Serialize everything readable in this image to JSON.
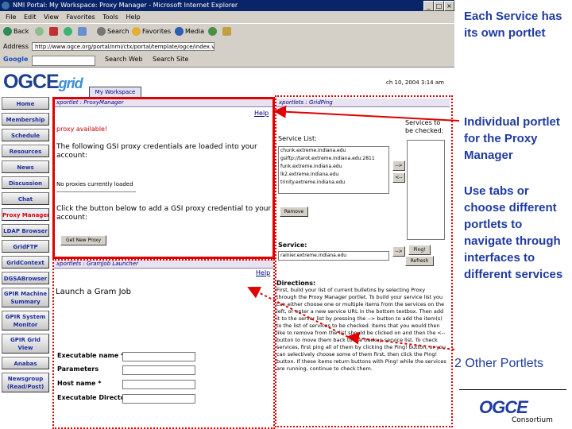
{
  "browser": {
    "window_title": "NMI Portal: My Workspace: Proxy Manager - Microsoft Internet Explorer",
    "menu": [
      "File",
      "Edit",
      "View",
      "Favorites",
      "Tools",
      "Help"
    ],
    "toolbar": {
      "back": "Back",
      "search": "Search",
      "favorites": "Favorites",
      "media": "Media"
    },
    "address_label": "Address",
    "address_value": "http://www.ogce.org/portal/nmi/ctx/portal/template/ogce/index.vm?js_pane=p-0f94ea56f0...",
    "google_label": "Google",
    "google_search": "Search Web",
    "google_site": "Search Site"
  },
  "page": {
    "logo_main": "OGCE",
    "logo_sub": "grid",
    "datestamp": "ch 10, 2004 3:14 am",
    "workspace_tab": "My Workspace",
    "nav": [
      {
        "label": "Home"
      },
      {
        "label": "Membership"
      },
      {
        "label": "Schedule"
      },
      {
        "label": "Resources"
      },
      {
        "label": "News"
      },
      {
        "label": "Discussion"
      },
      {
        "label": "Chat"
      },
      {
        "label": "Proxy Manager"
      },
      {
        "label": "LDAP Browser"
      },
      {
        "label": "GridFTP"
      },
      {
        "label": "GridContext"
      },
      {
        "label": "DGSABrowser"
      },
      {
        "label": "GPIR Machine Summary"
      },
      {
        "label": "GPIR System Monitor"
      },
      {
        "label": "GPIR Grid View"
      },
      {
        "label": "Anabas"
      },
      {
        "label": "Newsgroup (Read/Post)"
      }
    ]
  },
  "proxy_portlet": {
    "title": "xportlet : ProxyManager",
    "help": "Help",
    "status": "proxy available!",
    "loaded_text": "The following GSI proxy credentials are loaded into your account:",
    "none_text": "No proxies currently loaded",
    "add_text": "Click the button below to add a GSI proxy credential to your account:",
    "get_button": "Get New Proxy"
  },
  "gridping_portlet": {
    "title": "xportlets : GridPing",
    "service_list_label": "Service List:",
    "services_to_check_label": "Services to be checked:",
    "services": [
      "chunk.extreme.indiana.edu",
      "gsiftp://tarot.extreme.indiana.edu:2811",
      "funk.extreme.indiana.edu",
      "lk2.extreme.indiana.edu",
      "trinity.extreme.indiana.edu"
    ],
    "add_btn": "-->",
    "remove_btn": "<--",
    "remove_label": "Remove",
    "service_label": "Service:",
    "service_value": "rainier.extreme.indiana.edu",
    "ping_btn": "Ping!",
    "refresh_btn": "Refresh",
    "directions_label": "Directions:",
    "directions_text": "First, build your list of current bulletins by selecting Proxy through the Proxy Manager portlet. To build your service list you can either choose one or multiple items from the services on the left, or enter a new service URL in the bottom textbox. Then add it to the server list by pressing the --> button to add the item(s) to the list of services to be checked. Items that you would then like to remove from the list should be clicked on and then the <-- button to move them back to the backup service list. To check services, first ping all of them by clicking the Ping! button, or you can selectively choose some of them first, then click the Ping! button. If these items return buttons with Ping! while the services are running, continue to check them."
  },
  "gram_portlet": {
    "title": "xportlets : GramJob Launcher",
    "help": "Help",
    "heading": "Launch a Gram Job",
    "fields": [
      {
        "label": "Executable name *"
      },
      {
        "label": "Parameters"
      },
      {
        "label": "Host name *"
      },
      {
        "label": "Executable Directory"
      }
    ]
  },
  "annotations": {
    "each_service": "Each Service has its own portlet",
    "individual": "Individual portlet for the Proxy Manager",
    "use_tabs": "Use tabs or choose different portlets to navigate through interfaces to different services",
    "other_portlets": "2 Other Portlets",
    "consortium_logo": "OGCE",
    "consortium": "Consortium"
  },
  "colors": {
    "annotation_red": "#e00000",
    "annotation_blue": "#1f3ba0",
    "title_bar": "#0a246a",
    "nav_text": "#1e2f9e"
  }
}
